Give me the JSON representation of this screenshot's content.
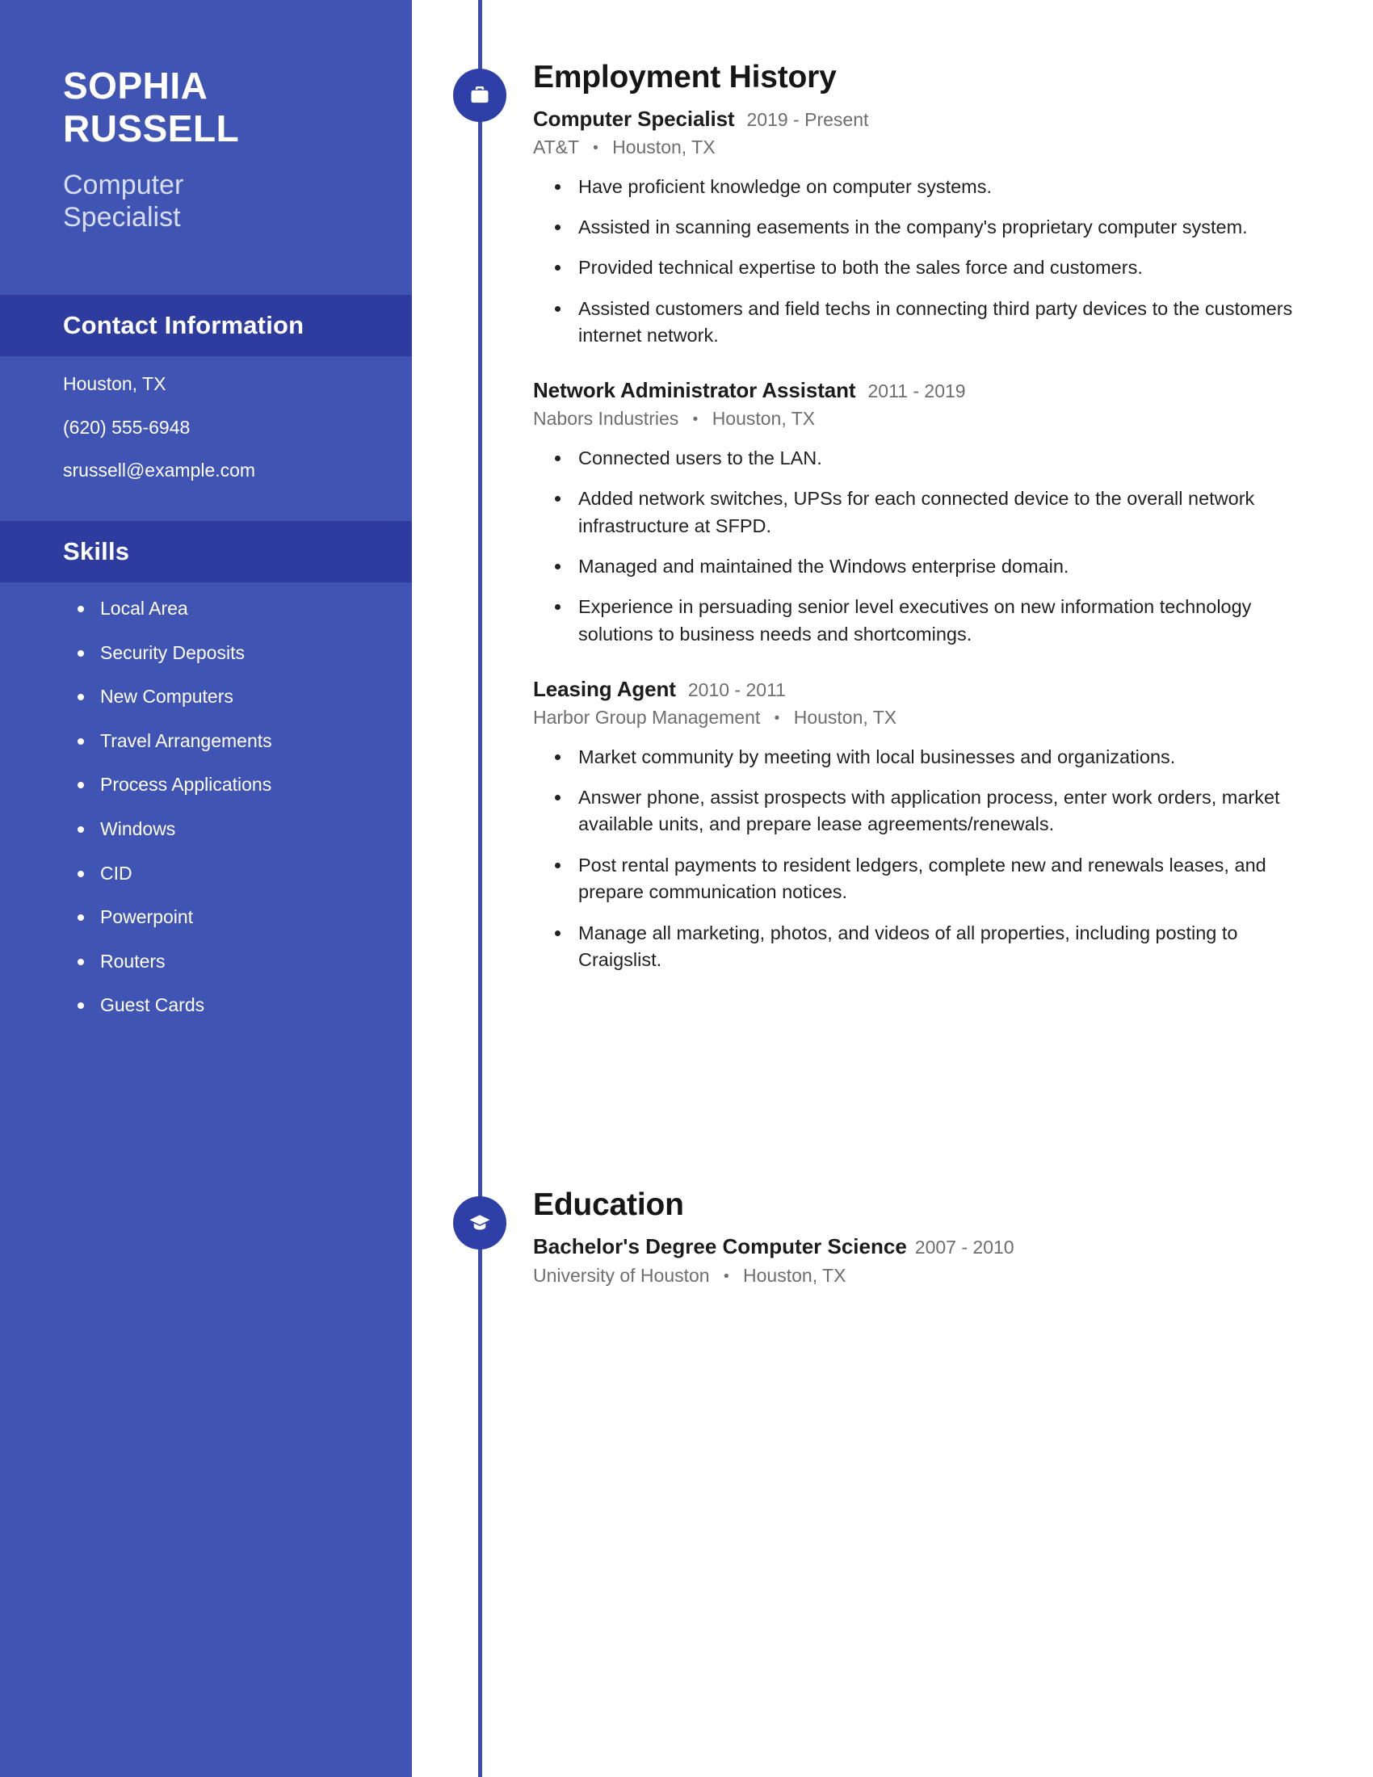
{
  "theme": {
    "sidebar_bg": "#4054b4",
    "sidebar_band_bg": "#2e3ca0",
    "badge_bg": "#2f3fa8",
    "timeline_line": "#3a4cb0",
    "text_dark": "#1c1c1c",
    "text_muted": "#6e6e6e"
  },
  "sidebar": {
    "name_first": "SOPHIA",
    "name_last": "RUSSELL",
    "job_title_line1": "Computer",
    "job_title_line2": "Specialist",
    "contact": {
      "heading": "Contact Information",
      "items": [
        "Houston, TX",
        "(620) 555-6948",
        "srussell@example.com"
      ]
    },
    "skills": {
      "heading": "Skills",
      "items": [
        "Local Area",
        "Security Deposits",
        "New Computers",
        "Travel Arrangements",
        "Process Applications",
        "Windows",
        "CID",
        "Powerpoint",
        "Routers",
        "Guest Cards"
      ]
    }
  },
  "employment": {
    "heading": "Employment History",
    "icon": "briefcase-icon",
    "entries": [
      {
        "role": "Computer Specialist",
        "dates": "2019 - Present",
        "company": "AT&T",
        "location": "Houston, TX",
        "bullets": [
          "Have proficient knowledge on computer systems.",
          "Assisted in scanning easements in the company's proprietary computer system.",
          "Provided technical expertise to both the sales force and customers.",
          "Assisted customers and field techs in connecting third party devices to the customers internet network."
        ]
      },
      {
        "role": "Network Administrator Assistant",
        "dates": "2011 - 2019",
        "company": "Nabors Industries",
        "location": "Houston, TX",
        "bullets": [
          "Connected users to the LAN.",
          "Added network switches, UPSs for each connected device to the overall network infrastructure at SFPD.",
          "Managed and maintained the Windows enterprise domain.",
          "Experience in persuading senior level executives on new information technology solutions to business needs and shortcomings."
        ]
      },
      {
        "role": "Leasing Agent",
        "dates": "2010 - 2011",
        "company": "Harbor Group Management",
        "location": "Houston, TX",
        "bullets": [
          "Market community by meeting with local businesses and organizations.",
          "Answer phone, assist prospects with application process, enter work orders, market available units, and prepare lease agreements/renewals.",
          "Post rental payments to resident ledgers, complete new and renewals leases, and prepare communication notices.",
          "Manage all marketing, photos, and videos of all properties, including posting to Craigslist."
        ]
      }
    ]
  },
  "education": {
    "heading": "Education",
    "icon": "graduation-cap-icon",
    "entries": [
      {
        "degree": "Bachelor's Degree Computer Science",
        "dates": "2007 - 2010",
        "school": "University of Houston",
        "location": "Houston, TX"
      }
    ]
  },
  "separator": "•"
}
